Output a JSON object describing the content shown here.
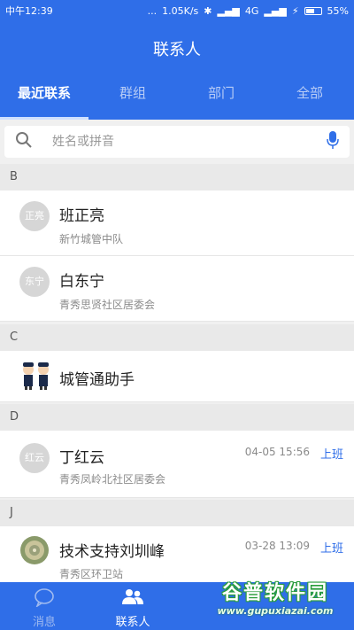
{
  "statusbar": {
    "time": "中午12:39",
    "dots": "...",
    "speed": "1.05K/s",
    "network": "4G",
    "battery": "55%"
  },
  "header": {
    "title": "联系人",
    "tabs": [
      "最近联系",
      "群组",
      "部门",
      "全部"
    ],
    "active_tab": 0
  },
  "search": {
    "placeholder": "姓名或拼音"
  },
  "sections": {
    "b": "B",
    "c": "C",
    "d": "D",
    "j": "J"
  },
  "contacts": [
    {
      "avatar": "正亮",
      "name": "班正亮",
      "sub": "新竹城管中队"
    },
    {
      "avatar": "东宁",
      "name": "白东宁",
      "sub": "青秀思贤社区居委会"
    },
    {
      "name": "城管通助手",
      "avatar_icon": "police-mascot-icon"
    },
    {
      "avatar": "红云",
      "name": "丁红云",
      "sub": "青秀凤岭北社区居委会",
      "time": "04-05 15:56",
      "status": "上班"
    },
    {
      "name": "技术支持刘圳峰",
      "sub": "青秀区环卫站",
      "time": "03-28 13:09",
      "status": "上班",
      "avatar_icon": "shell-photo-icon"
    }
  ],
  "bottom_nav": {
    "messages": "消息",
    "contacts": "联系人"
  },
  "watermark": {
    "text": "谷普软件园",
    "url": "www.gupuxiazai.com"
  },
  "colors": {
    "primary": "#2f6ee8",
    "accent_status": "#2f6ee8"
  }
}
